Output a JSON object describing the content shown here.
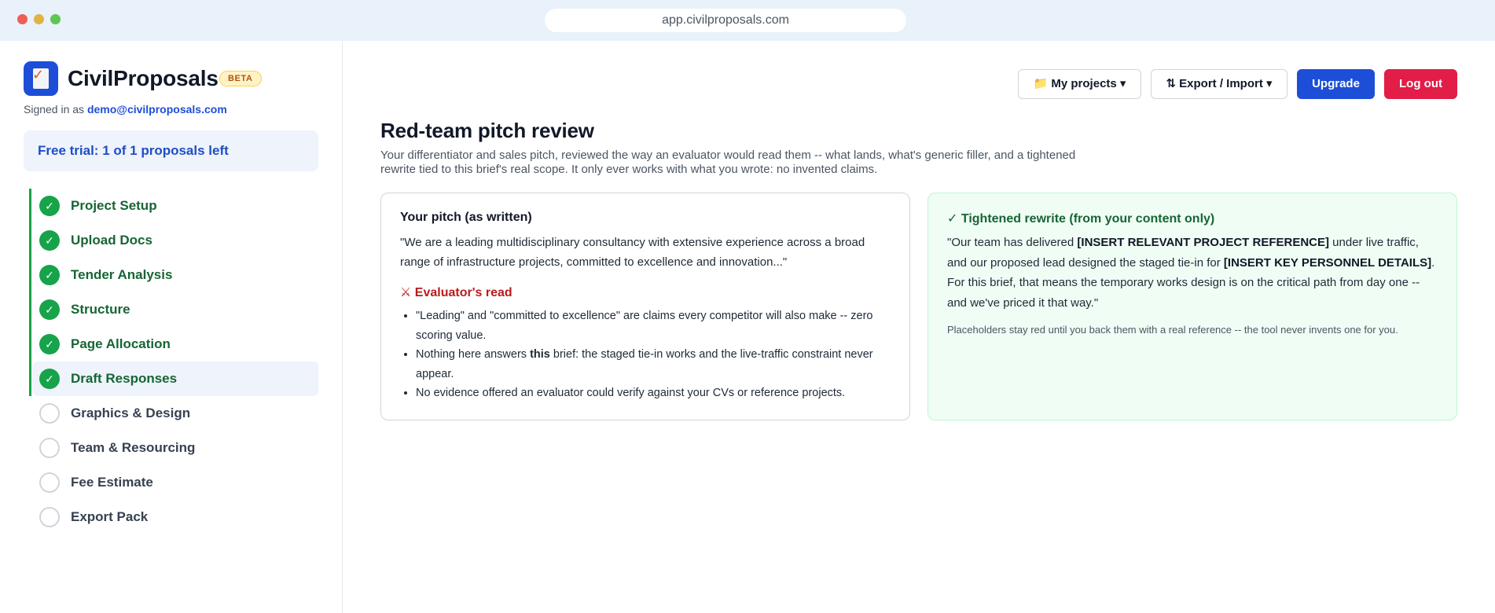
{
  "browser": {
    "url": "app.civilproposals.com"
  },
  "brand": {
    "name": "CivilProposals",
    "badge": "BETA",
    "icon": "document-check-icon"
  },
  "account": {
    "signed_in_prefix": "Signed in as ",
    "email": "demo@civilproposals.com"
  },
  "trial": {
    "text": "Free trial: 1 of 1 proposals left"
  },
  "steps": [
    {
      "label": "Project Setup",
      "status": "done",
      "mark": "✓"
    },
    {
      "label": "Upload Docs",
      "status": "done",
      "mark": "✓"
    },
    {
      "label": "Tender Analysis",
      "status": "done",
      "mark": "✓"
    },
    {
      "label": "Structure",
      "status": "done",
      "mark": "✓"
    },
    {
      "label": "Page Allocation",
      "status": "done",
      "mark": "✓"
    },
    {
      "label": "Draft Responses",
      "status": "done",
      "mark": "✓",
      "active": true
    },
    {
      "label": "Graphics & Design",
      "status": "todo",
      "mark": ""
    },
    {
      "label": "Team & Resourcing",
      "status": "todo",
      "mark": ""
    },
    {
      "label": "Fee Estimate",
      "status": "todo",
      "mark": ""
    },
    {
      "label": "Export Pack",
      "status": "todo",
      "mark": ""
    }
  ],
  "toolbar": {
    "projects_label": "📁 My projects ▾",
    "export_label": "⇅ Export / Import ▾",
    "upgrade_label": "Upgrade",
    "logout_label": "Log out"
  },
  "page": {
    "title": "Red-team pitch review",
    "subtitle": "Your differentiator and sales pitch, reviewed the way an evaluator would read them -- what lands, what's generic filler, and a tightened rewrite tied to this brief's real scope. It only ever works with what you wrote: no invented claims."
  },
  "original": {
    "title": "Your pitch (as written)",
    "text": "\"We are a leading multidisciplinary consultancy with extensive experience across a broad range of infrastructure projects, committed to excellence and innovation...\"",
    "evaluator_title": "⚔ Evaluator's read",
    "points": {
      "p1": "\"Leading\" and \"committed to excellence\" are claims every competitor will also make -- zero scoring value.",
      "p2_before": "Nothing here answers ",
      "p2_bold": "this",
      "p2_after": " brief: the staged tie-in works and the live-traffic constraint never appear.",
      "p3": "No evidence offered an evaluator could verify against your CVs or reference projects."
    }
  },
  "rewrite": {
    "title": "✓ Tightened rewrite (from your content only)",
    "part1": "\"Our team has delivered ",
    "placeholder1": "[INSERT RELEVANT PROJECT REFERENCE]",
    "part2": " under live traffic, and our proposed lead designed the staged tie-in for ",
    "placeholder2": "[INSERT KEY PERSONNEL DETAILS]",
    "part3": ". For this brief, that means the temporary works design is on the critical path from day one -- and we've priced it that way.\"",
    "note": "Placeholders stay red until you back them with a real reference -- the tool never invents one for you."
  }
}
